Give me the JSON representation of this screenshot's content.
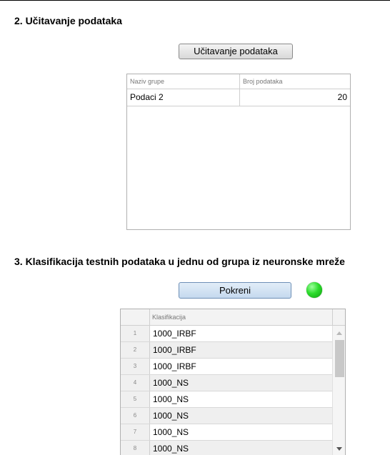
{
  "section_load": {
    "title": "2. Učitavanje podataka",
    "button_label": "Učitavanje podataka",
    "table": {
      "columns": [
        "Naziv grupe",
        "Broj podataka"
      ],
      "rows": [
        {
          "group": "Podaci 2",
          "count": "20"
        }
      ]
    }
  },
  "section_classify": {
    "title": "3. Klasifikacija testnih podataka u jednu od grupa iz neuronske mreže",
    "button_label": "Pokreni",
    "status_color": "#2bdc2b",
    "table": {
      "column": "Klasifikacija",
      "rows": [
        {
          "index": "1",
          "value": "1000_IRBF"
        },
        {
          "index": "2",
          "value": "1000_IRBF"
        },
        {
          "index": "3",
          "value": "1000_IRBF"
        },
        {
          "index": "4",
          "value": "1000_NS"
        },
        {
          "index": "5",
          "value": "1000_NS"
        },
        {
          "index": "6",
          "value": "1000_NS"
        },
        {
          "index": "7",
          "value": "1000_NS"
        },
        {
          "index": "8",
          "value": "1000_NS"
        }
      ]
    }
  }
}
